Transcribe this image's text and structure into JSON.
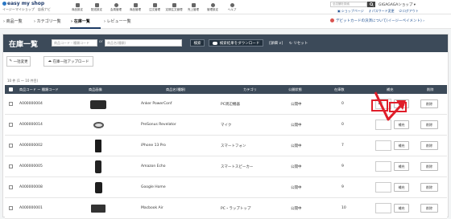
{
  "header": {
    "logo_text": "easy my shop",
    "logo_sub": "イージーマイショップ　店長ナビ",
    "nav": [
      {
        "label": "商品設定",
        "icon": "tag-icon"
      },
      {
        "label": "配送設定",
        "icon": "truck-icon"
      },
      {
        "label": "会員管理",
        "icon": "person-icon"
      },
      {
        "label": "商品管理",
        "icon": "box-icon"
      },
      {
        "label": "注文管理",
        "icon": "cart-icon"
      },
      {
        "label": "定期注文管理",
        "icon": "calendar-icon"
      },
      {
        "label": "売上管理",
        "icon": "chart-icon"
      },
      {
        "label": "管理設定",
        "icon": "info-icon"
      },
      {
        "label": "ヘルプ",
        "icon": "help-icon"
      }
    ],
    "search_placeholder": "全店舗を検索",
    "shop_name": "GIGAGAGAショップ ▾",
    "links": [
      "ショップページ",
      "パスワード変更",
      "ログアウト"
    ]
  },
  "subnav": {
    "items": [
      "商品一覧",
      "カテゴリ一覧",
      "在庫一覧",
      "レビュー一覧"
    ],
    "notice": "デビットカードの決済について(イージーペイメント)"
  },
  "inventory": {
    "title": "在庫一覧",
    "code_placeholder": "商品コード・種類コード",
    "or_label": "or",
    "name_placeholder": "商品名(種類)",
    "search_label": "検索",
    "download_label": "検索結果をダウンロード",
    "detail_label": "[詳細 ∨]",
    "reset_label": "リセット",
    "bulk_edit_label": "一括変更",
    "bulk_upload_label": "在庫一括アップロード",
    "count_text": "10 件 (1 ～ 10 件目)",
    "columns": {
      "code": "商品コード ー 種類コード",
      "image": "商品画像",
      "name": "商品名(種類)",
      "category": "カテゴリ",
      "status": "公開状態",
      "stock": "在庫数",
      "restock": "補充",
      "delete": "削除"
    },
    "rows": [
      {
        "code": "A000000004",
        "name": "Anker PowerConf",
        "category": "PC周辺機器",
        "status": "公開中",
        "stock": "0",
        "qty": "10",
        "restock": "補充",
        "delete": "削除"
      },
      {
        "code": "A000000014",
        "name": "PreSonus Revelator",
        "category": "マイク",
        "status": "公開中",
        "stock": "0",
        "qty": "",
        "restock": "補充",
        "delete": "削除"
      },
      {
        "code": "A000000002",
        "name": "iPhone 13 Pro",
        "category": "スマートフォン",
        "status": "公開中",
        "stock": "7",
        "qty": "",
        "restock": "補充",
        "delete": "削除"
      },
      {
        "code": "A000000005",
        "name": "Amazon Echo",
        "category": "スマートスピーカー",
        "status": "公開中",
        "stock": "9",
        "qty": "",
        "restock": "補充",
        "delete": "削除"
      },
      {
        "code": "A000000008",
        "name": "Google Home",
        "category": "",
        "status": "公開中",
        "stock": "9",
        "qty": "",
        "restock": "補充",
        "delete": "削除"
      },
      {
        "code": "A000000001",
        "name": "Macbook Air",
        "category": "PC・ラップトップ",
        "status": "公開中",
        "stock": "10",
        "qty": "",
        "restock": "補充",
        "delete": "削除"
      }
    ]
  }
}
